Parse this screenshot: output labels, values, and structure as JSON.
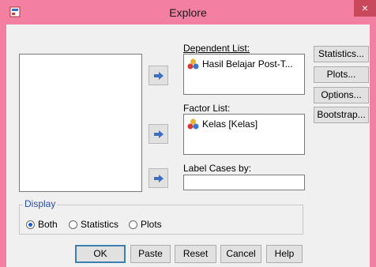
{
  "window": {
    "title": "Explore",
    "close_label": "×"
  },
  "dependent": {
    "label": "Dependent List:",
    "items": [
      "Hasil Belajar Post-T..."
    ]
  },
  "factor": {
    "label": "Factor List:",
    "items": [
      "Kelas [Kelas]"
    ]
  },
  "label_cases": {
    "label": "Label Cases by:",
    "value": ""
  },
  "side_buttons": [
    "Statistics...",
    "Plots...",
    "Options...",
    "Bootstrap..."
  ],
  "display": {
    "title": "Display",
    "options": [
      "Both",
      "Statistics",
      "Plots"
    ],
    "selected": "Both"
  },
  "bottom_buttons": [
    "OK",
    "Paste",
    "Reset",
    "Cancel",
    "Help"
  ],
  "colors": {
    "title_bar": "#f37fa3",
    "close_button": "#c9485b",
    "dialog_bg": "#f0f0f0",
    "group_title": "#2a4da0"
  }
}
